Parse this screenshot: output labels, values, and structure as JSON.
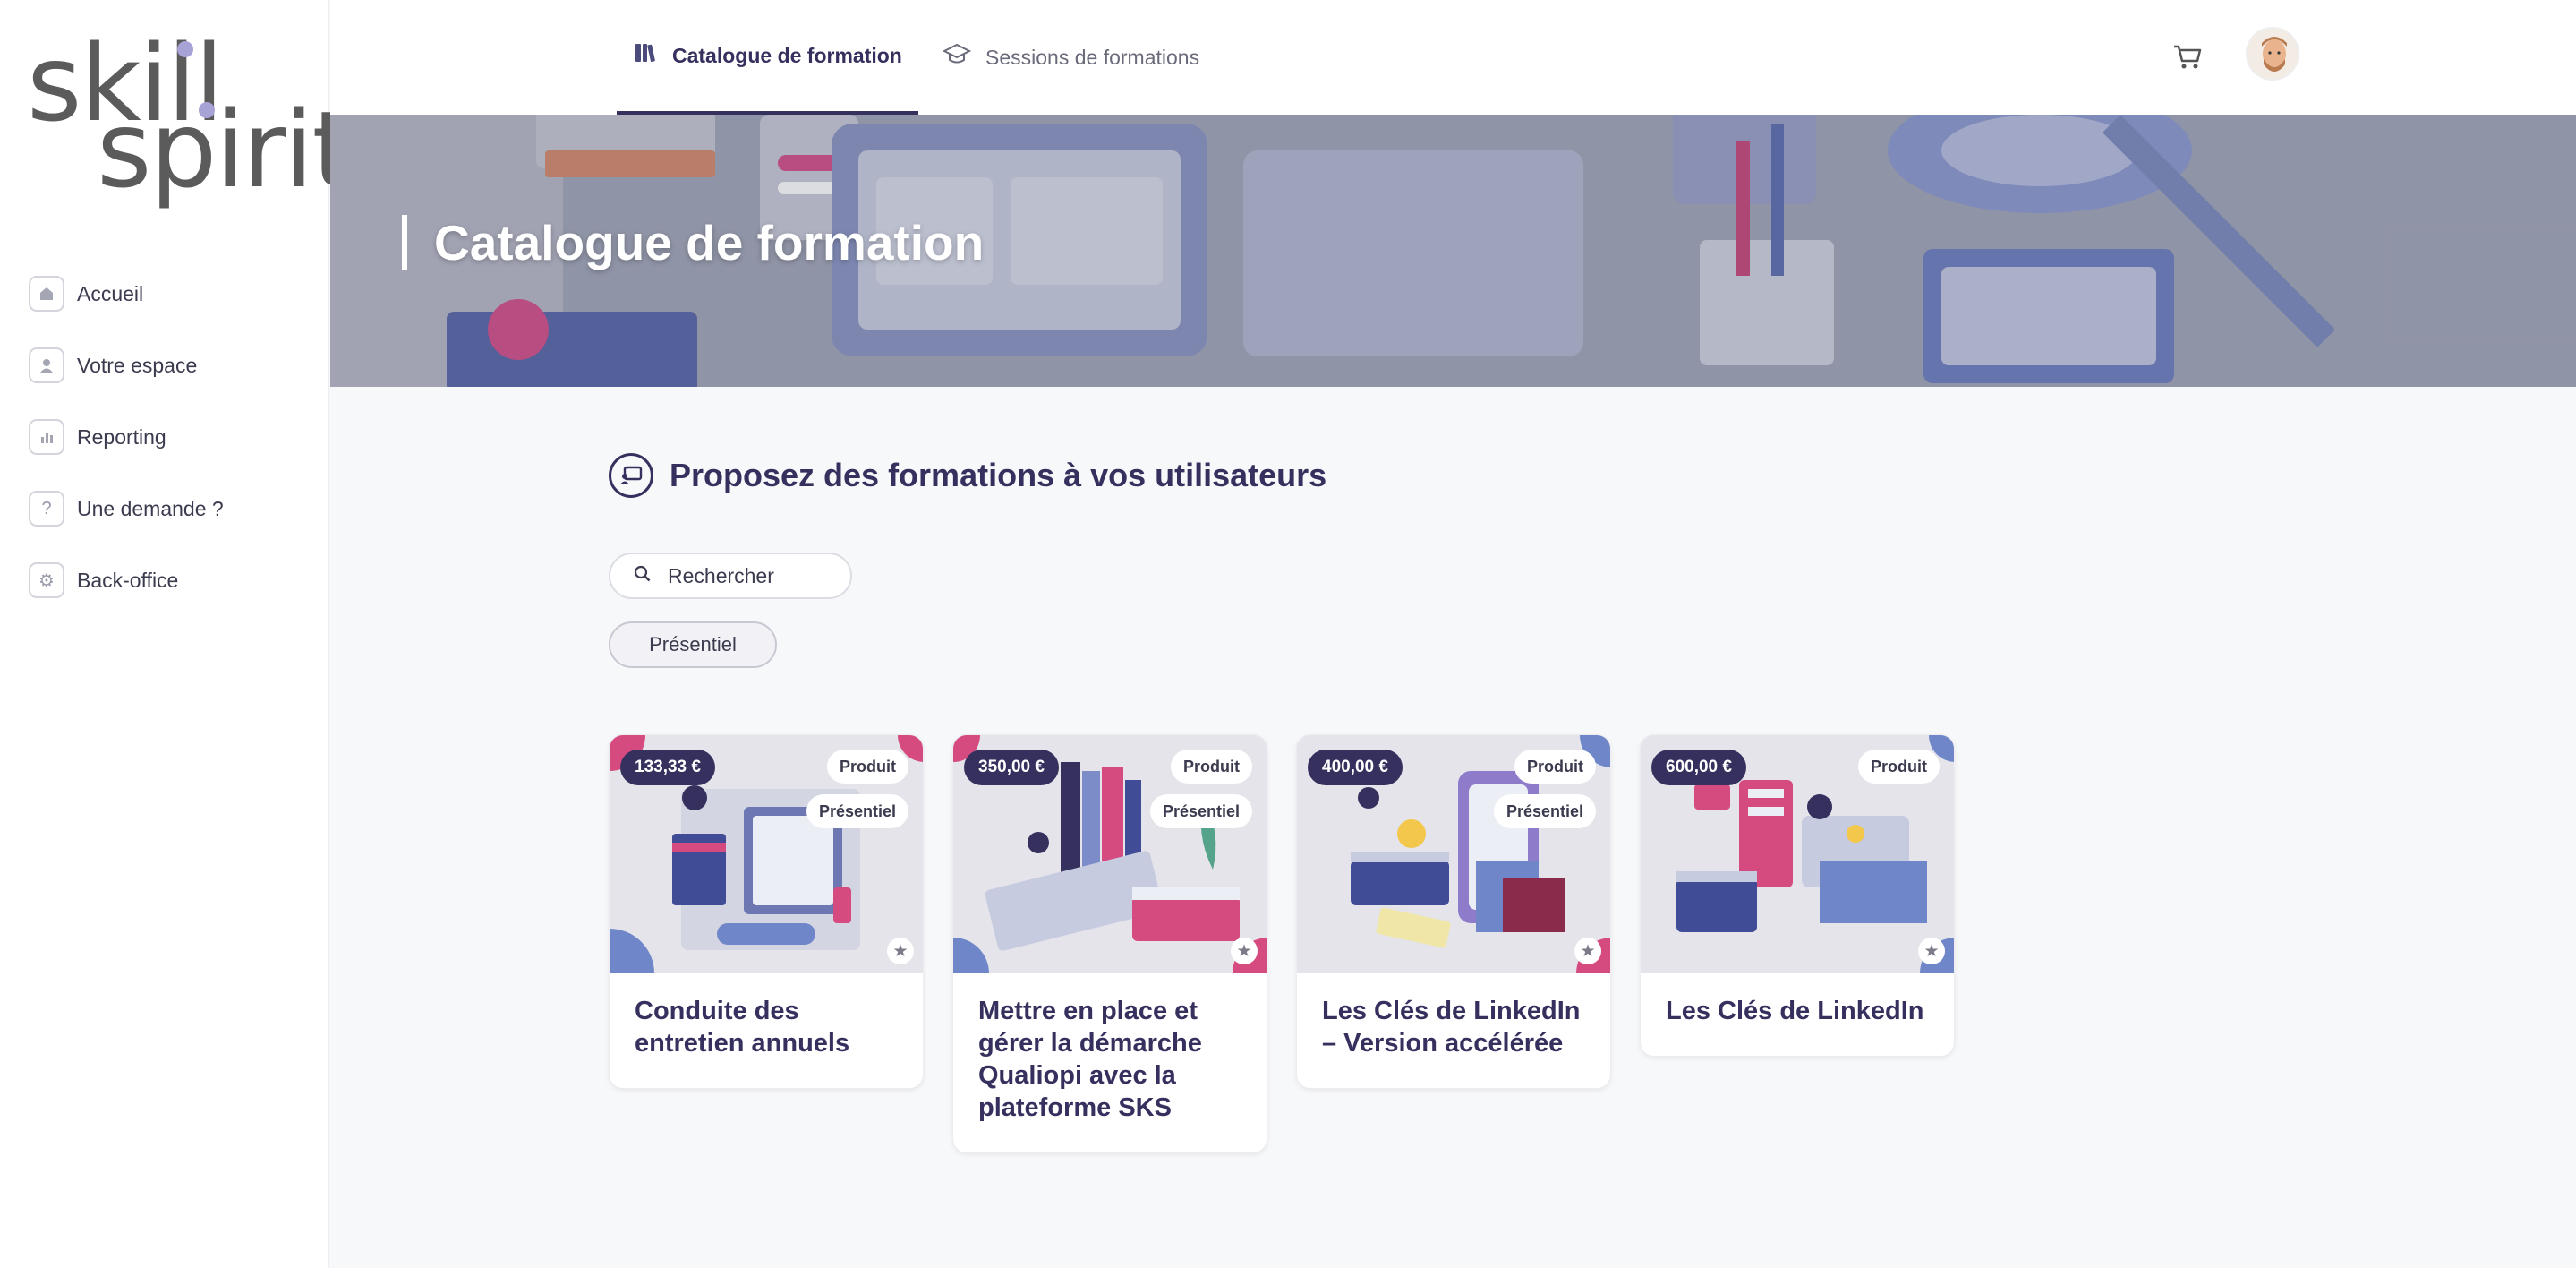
{
  "brand": {
    "logo_line1": "skill",
    "logo_line2": "spirit",
    "logo_color": "#5b5b5b",
    "dot_color": "#a8a3d6"
  },
  "sidebar": {
    "items": [
      {
        "label": "Accueil",
        "icon": "home-icon"
      },
      {
        "label": "Votre espace",
        "icon": "user-icon"
      },
      {
        "label": "Reporting",
        "icon": "bar-chart-icon"
      },
      {
        "label": "Une demande ?",
        "icon": "question-icon"
      },
      {
        "label": "Back-office",
        "icon": "gear-icon"
      }
    ]
  },
  "topbar": {
    "tabs": [
      {
        "label": "Catalogue de formation",
        "icon": "books-icon",
        "active": true
      },
      {
        "label": "Sessions de formations",
        "icon": "graduation-cap-icon",
        "active": false
      }
    ],
    "cart_icon": "cart-icon",
    "avatar_icon": "avatar"
  },
  "banner": {
    "title": "Catalogue de formation"
  },
  "main": {
    "section_title": "Proposez des formations à vos utilisateurs",
    "search_placeholder": "Rechercher",
    "filter_label": "Présentiel"
  },
  "cards": [
    {
      "price": "133,33 €",
      "type": "Produit",
      "mode": "Présentiel",
      "title": "Conduite des entretien annuels"
    },
    {
      "price": "350,00 €",
      "type": "Produit",
      "mode": "Présentiel",
      "title": "Mettre en place et gérer la démarche Qualiopi avec la plateforme SKS"
    },
    {
      "price": "400,00 €",
      "type": "Produit",
      "mode": "Présentiel",
      "title": "Les Clés de LinkedIn – Version accélérée"
    },
    {
      "price": "600,00 €",
      "type": "Produit",
      "mode": "",
      "title": "Les Clés de LinkedIn"
    }
  ],
  "colors": {
    "primary": "#35305e",
    "accent_pink": "#d64b7f",
    "accent_blue": "#6f86c9"
  }
}
